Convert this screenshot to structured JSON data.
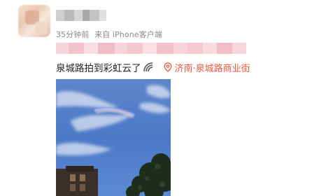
{
  "post": {
    "meta": {
      "time": "35分钟前",
      "source_prefix": "来自",
      "source": "iPhone客户端"
    },
    "text": "泉城路拍到彩虹云了",
    "location": "济南·泉城路商业街",
    "icons": {
      "rainbow": "rainbow-icon",
      "location": "location-pin-icon"
    },
    "colors": {
      "location_text": "#e8573d",
      "meta_text": "#8a8a8a",
      "body_text": "#222222",
      "sky": "#4f7ac4"
    }
  }
}
